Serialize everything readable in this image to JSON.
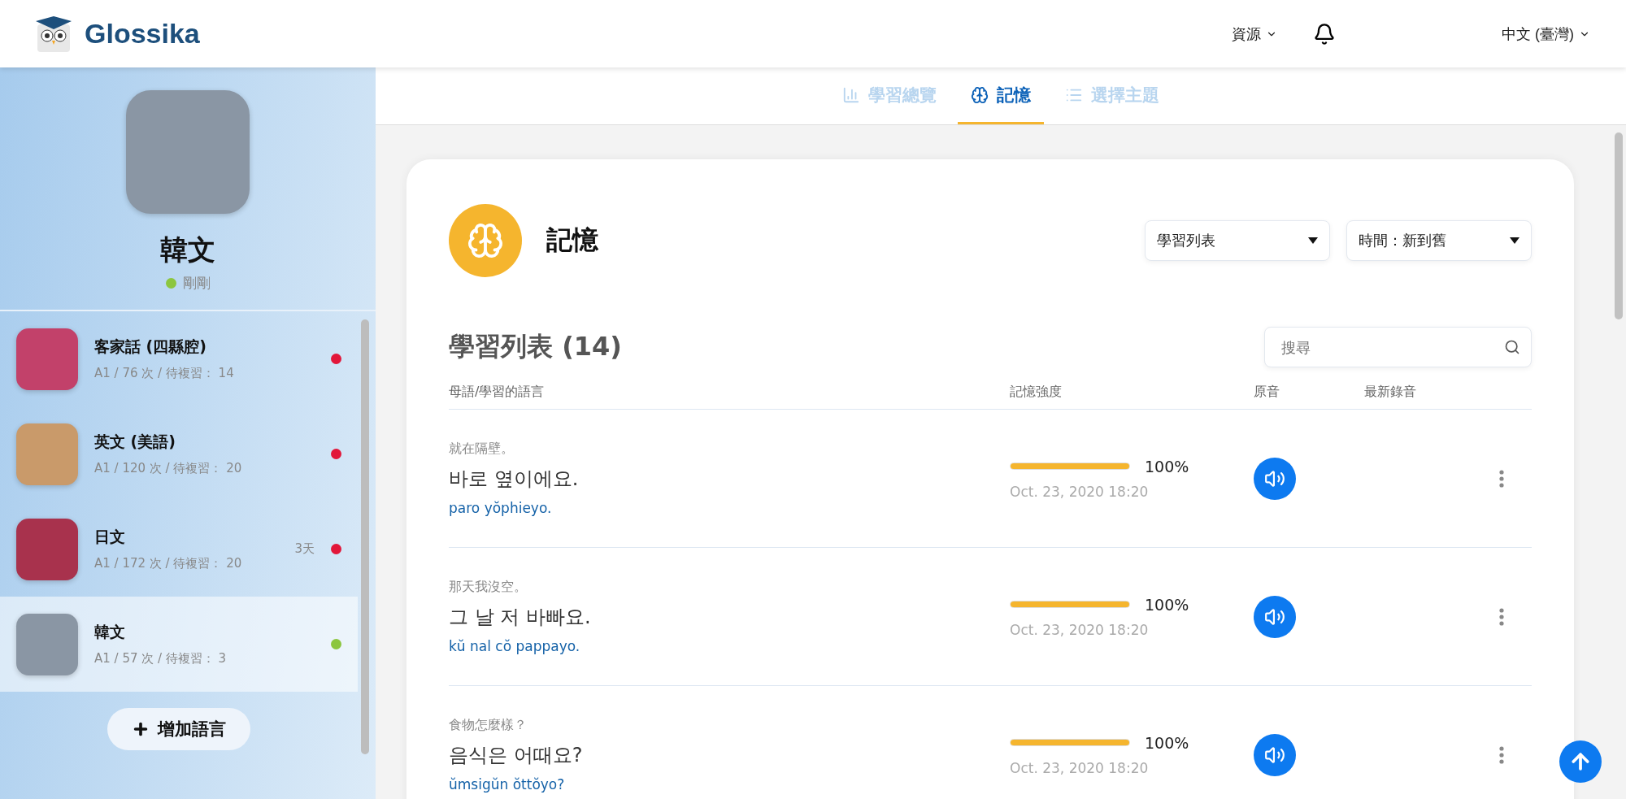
{
  "header": {
    "logo": "Glossika",
    "menu": "資源",
    "language": "中文 (臺灣)"
  },
  "profile": {
    "name": "韓文",
    "status": "剛剛"
  },
  "languages": [
    {
      "name": "客家話 (四縣腔)",
      "stats": "A1 / 76 次 / 待複習： 14",
      "color": "#e2173a",
      "selected": false
    },
    {
      "name": "英文 (美語)",
      "stats": "A1 / 120 次 / 待複習： 20",
      "color": "#e2173a",
      "selected": false
    },
    {
      "name": "日文",
      "stats": "A1 / 172 次 / 待複習： 20",
      "note": "3天",
      "color": "#e2173a",
      "selected": false
    },
    {
      "name": "韓文",
      "stats": "A1 / 57 次 / 待複習： 3",
      "color": "#8cc63f",
      "selected": true
    }
  ],
  "add_language": "增加語言",
  "tabs": [
    {
      "label": "學習總覽",
      "kind": "chart",
      "selected": false
    },
    {
      "label": "記憶",
      "kind": "brain",
      "selected": true
    },
    {
      "label": "選擇主題",
      "kind": "list",
      "selected": false
    }
  ],
  "card": {
    "title": "記憶",
    "filters": [
      "學習列表",
      "時間：新到舊"
    ],
    "list_title": "學習列表 (14)",
    "search": {
      "placeholder": "搜尋"
    },
    "columns": [
      "母語/學習的語言",
      "記憶強度",
      "原音",
      "最新錄音"
    ],
    "rows": [
      {
        "native": "就在隔壁。",
        "target": "바로 옆이에요.",
        "romanization": "paro yŏphieyo.",
        "level": 1,
        "percent": "100%",
        "date": "Oct. 23, 2020 18:20"
      },
      {
        "native": "那天我沒空。",
        "target": "그 날 저 바빠요.",
        "romanization": "kŭ nal cŏ pappayo.",
        "level": 1,
        "percent": "100%",
        "date": "Oct. 23, 2020 18:20"
      },
      {
        "native": "食物怎麼樣？",
        "target": "음식은 어때요?",
        "romanization": "ŭmsigŭn ŏttŏyo?",
        "level": 1,
        "percent": "100%",
        "date": "Oct. 23, 2020 18:20"
      }
    ]
  }
}
